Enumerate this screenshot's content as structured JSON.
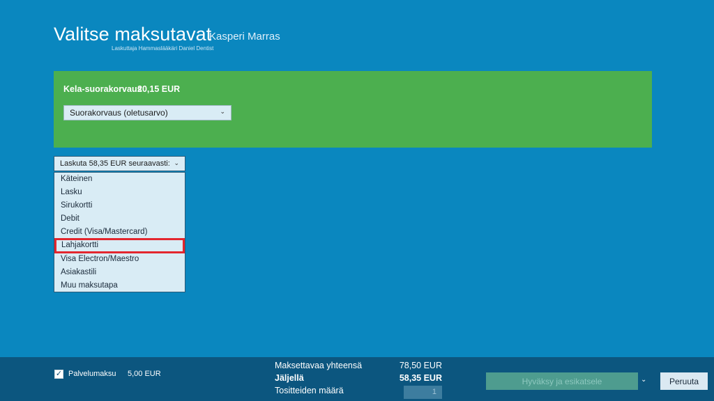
{
  "header": {
    "title": "Valitse maksutavat",
    "patient": "Kasperi Marras",
    "biller": "Laskuttaja Hammaslääkäri Daniel Dentist"
  },
  "kela": {
    "label": "Kela-suorakorvaus",
    "amount": "20,15 EUR",
    "select_value": "Suorakorvaus (oletusarvo)"
  },
  "payment": {
    "select_value": "Laskuta 58,35 EUR seuraavasti:",
    "highlighted_index": 5,
    "options": [
      "Käteinen",
      "Lasku",
      "Sirukortti",
      "Debit",
      "Credit (Visa/Mastercard)",
      "Lahjakortti",
      "Visa Electron/Maestro",
      "Asiakastili",
      "Muu maksutapa"
    ]
  },
  "colors": {
    "background": "#0a87bf",
    "green_panel": "#4caf4f",
    "footer": "#0c567f",
    "highlight": "#e3262e"
  },
  "footer": {
    "service_fee_checked": true,
    "service_fee_label": "Palvelumaksu",
    "service_fee_amount": "5,00 EUR",
    "total_label": "Maksettavaa yhteensä",
    "total_value": "78,50 EUR",
    "remaining_label": "Jäljellä",
    "remaining_value": "58,35 EUR",
    "receipts_label": "Tositteiden määrä",
    "receipts_value": "1",
    "approve_label": "Hyväksy ja esikatsele",
    "cancel_label": "Peruuta"
  }
}
